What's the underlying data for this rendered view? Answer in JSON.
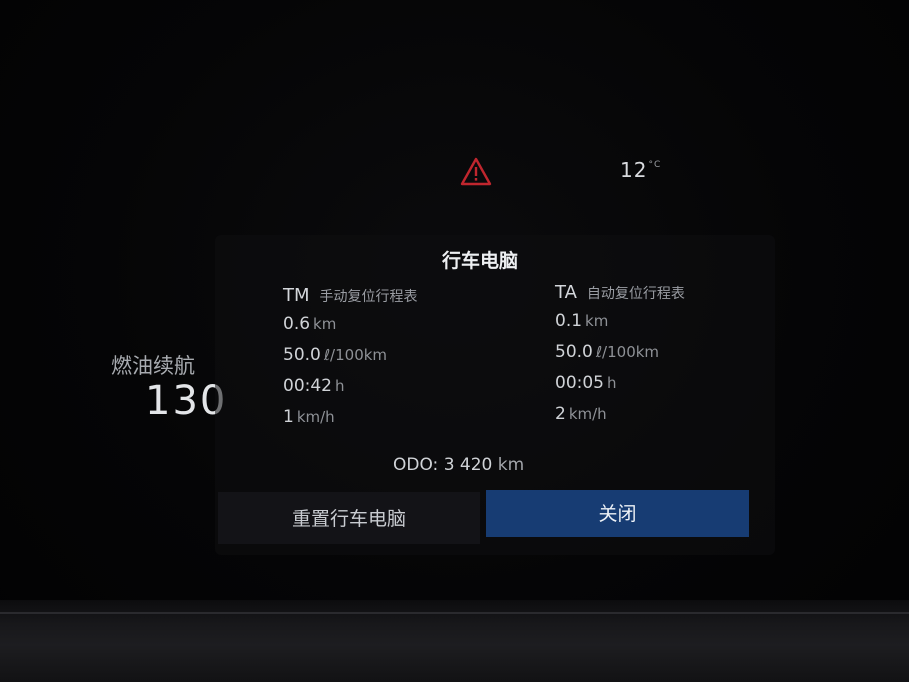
{
  "status": {
    "warning_icon": "warning-triangle-icon",
    "warning_color": "#c0262e",
    "temperature_value": "12",
    "temperature_unit": "°C"
  },
  "trip_computer": {
    "title": "行车电脑",
    "tm": {
      "code": "TM",
      "label": "手动复位行程表",
      "distance": {
        "value": "0.6",
        "unit": "km"
      },
      "consumption": {
        "value": "50.0",
        "unit": "ℓ/100km"
      },
      "time": {
        "value": "00:42",
        "unit": "h"
      },
      "speed": {
        "value": "1",
        "unit": "km/h"
      }
    },
    "ta": {
      "code": "TA",
      "label": "自动复位行程表",
      "distance": {
        "value": "0.1",
        "unit": "km"
      },
      "consumption": {
        "value": "50.0",
        "unit": "ℓ/100km"
      },
      "time": {
        "value": "00:05",
        "unit": "h"
      },
      "speed": {
        "value": "2",
        "unit": "km/h"
      }
    },
    "odo": {
      "label": "ODO:",
      "value": "3 420",
      "unit": "km"
    }
  },
  "range": {
    "label": "燃油续航",
    "value": "130"
  },
  "buttons": {
    "reset_label": "重置行车电脑",
    "close_label": "关闭",
    "close_color": "#173c73"
  }
}
